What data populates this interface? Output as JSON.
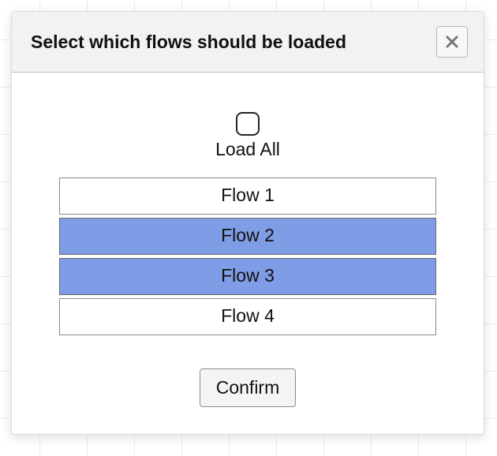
{
  "dialog": {
    "title": "Select which flows should be loaded",
    "load_all_label": "Load All",
    "load_all_checked": false,
    "confirm_label": "Confirm",
    "close_icon": "close-icon"
  },
  "flows": [
    {
      "label": "Flow 1",
      "selected": false
    },
    {
      "label": "Flow 2",
      "selected": true
    },
    {
      "label": "Flow 3",
      "selected": true
    },
    {
      "label": "Flow 4",
      "selected": false
    }
  ],
  "colors": {
    "selected_bg": "#7f9ce6",
    "header_bg": "#f2f2f2"
  }
}
